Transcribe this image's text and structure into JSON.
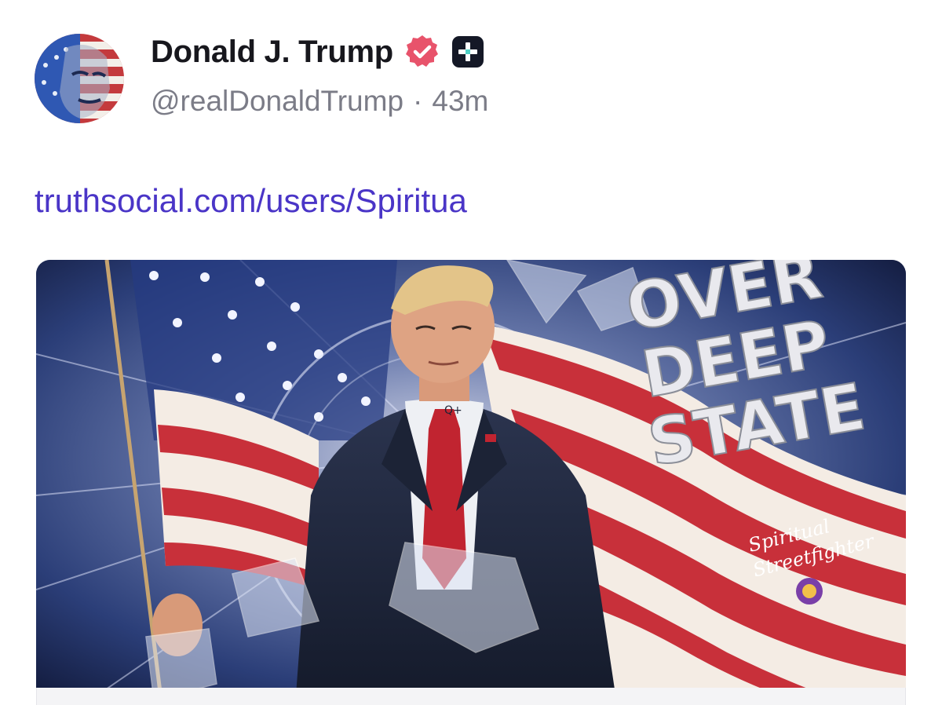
{
  "author": {
    "display_name": "Donald J. Trump",
    "handle": "@realDonaldTrump",
    "separator": "·",
    "timestamp": "43m",
    "verified_icon": "verified-badge-icon",
    "plus_icon": "truth-plus-icon",
    "badge_color": "#e8536b"
  },
  "post": {
    "link_text": "truthsocial.com/users/Spiritua",
    "link_color": "#4a35c7"
  },
  "media": {
    "poster_lines": [
      "OVER",
      "DEEP",
      "STATE"
    ],
    "watermark_line1": "Spiritual",
    "watermark_line2": "Streetfighter",
    "lapel_text": "Q+"
  }
}
